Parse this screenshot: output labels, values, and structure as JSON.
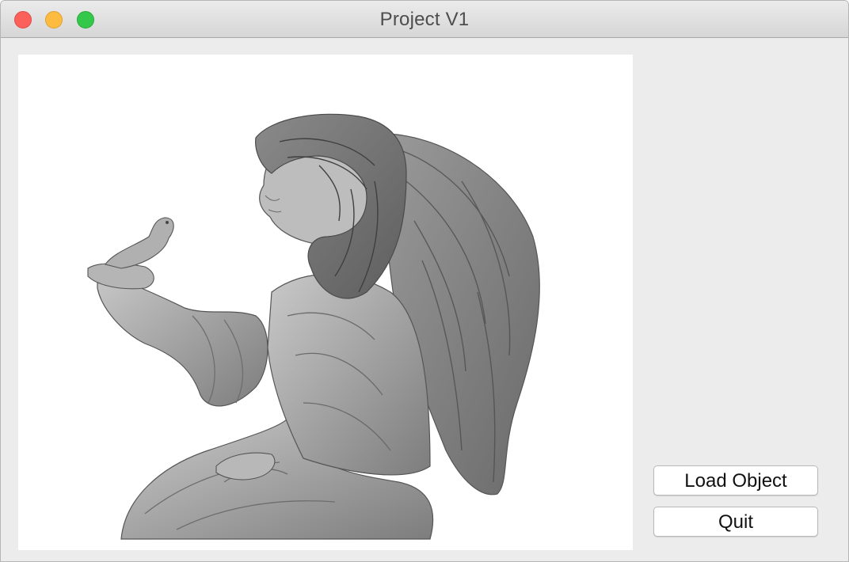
{
  "window": {
    "title": "Project V1",
    "controls": [
      "close",
      "minimize",
      "zoom"
    ]
  },
  "viewport": {
    "content": "3D render of kneeling angel figurine holding a bird",
    "background": "#ffffff",
    "model_color": "#a8a8a8"
  },
  "buttons": {
    "load_label": "Load Object",
    "quit_label": "Quit"
  }
}
